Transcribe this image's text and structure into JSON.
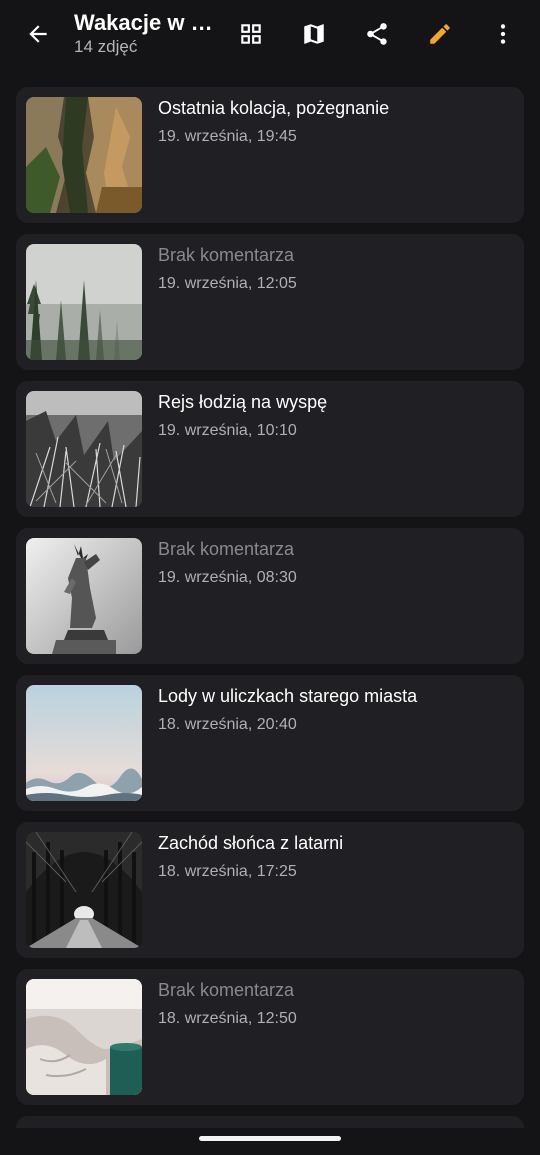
{
  "header": {
    "title": "Wakacje w …",
    "subtitle": "14 zdjęć",
    "icons": {
      "back": "arrow-back-icon",
      "grid": "grid-view-icon",
      "map": "map-icon",
      "share": "share-icon",
      "edit": "edit-pencil-icon",
      "more": "more-vertical-icon"
    },
    "edit_color": "#f5a623"
  },
  "photos": [
    {
      "caption": "Ostatnia kolacja, pożegnanie",
      "date": "19. września, 19:45",
      "has_comment": true,
      "thumb": "rocky-cliffs"
    },
    {
      "caption": "Brak komentarza",
      "date": "19. września, 12:05",
      "has_comment": false,
      "thumb": "misty-forest"
    },
    {
      "caption": "Rejs łodzią na wyspę",
      "date": "19. września, 10:10",
      "has_comment": true,
      "thumb": "dry-grass"
    },
    {
      "caption": "Brak komentarza",
      "date": "19. września, 08:30",
      "has_comment": false,
      "thumb": "statue-of-liberty"
    },
    {
      "caption": "Lody w uliczkach starego miasta",
      "date": "18. września, 20:40",
      "has_comment": true,
      "thumb": "sky-above-clouds"
    },
    {
      "caption": "Zachód słońca z latarni",
      "date": "18. września, 17:25",
      "has_comment": true,
      "thumb": "tree-tunnel"
    },
    {
      "caption": "Brak komentarza",
      "date": "18. września, 12:50",
      "has_comment": false,
      "thumb": "blanket-and-mug"
    }
  ],
  "colors": {
    "background": "#141416",
    "card": "#202024",
    "muted_caption": "#8a8a8e"
  }
}
